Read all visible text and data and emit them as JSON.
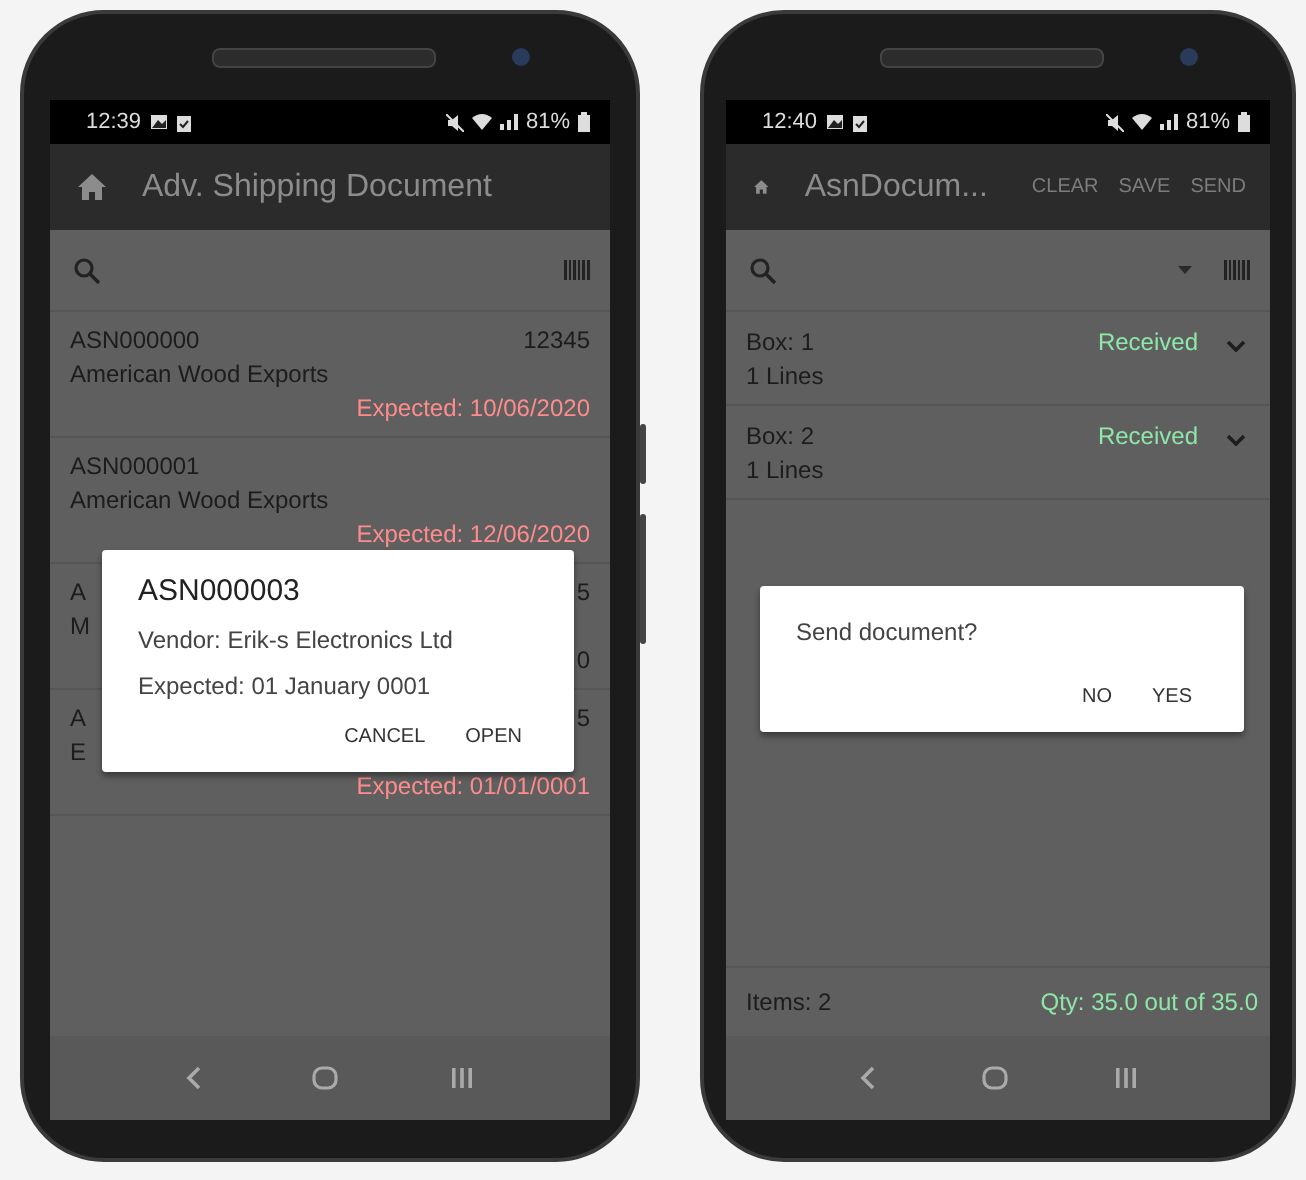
{
  "phones": [
    {
      "status_bar": {
        "time": "12:39",
        "battery": "81%"
      },
      "app_bar": {
        "title": "Adv. Shipping Document"
      },
      "search_bar": {
        "dropdown": false
      },
      "list": [
        {
          "kind": "document",
          "id": "ASN000000",
          "number": "12345",
          "vendor": "American Wood Exports",
          "expected": "Expected: 10/06/2020",
          "late": true
        },
        {
          "kind": "document",
          "id": "ASN000001",
          "vendor": "American Wood Exports",
          "expected": "Expected: 12/06/2020",
          "late": true
        },
        {
          "kind": "document",
          "id": "A",
          "number": "5",
          "vendor": "M",
          "expected": "0",
          "late": false
        },
        {
          "kind": "document",
          "id": "A",
          "number": "5",
          "vendor": "E",
          "expected": "Expected: 01/01/0001",
          "late": true
        }
      ],
      "dialog": {
        "title": "ASN000003",
        "lines": [
          "Vendor: Erik-s Electronics Ltd",
          "Expected: 01 January 0001"
        ],
        "buttons": [
          "CANCEL",
          "OPEN"
        ]
      }
    },
    {
      "status_bar": {
        "time": "12:40",
        "battery": "81%"
      },
      "app_bar": {
        "title": "AsnDocum...",
        "actions": [
          "CLEAR",
          "SAVE",
          "SEND"
        ]
      },
      "search_bar": {
        "dropdown": true
      },
      "list": [
        {
          "kind": "box",
          "title": "Box: 1",
          "lines": "1 Lines",
          "status": "Received"
        },
        {
          "kind": "box",
          "title": "Box: 2",
          "lines": "1 Lines",
          "status": "Received"
        }
      ],
      "dialog": {
        "lines": [
          "Send document?"
        ],
        "buttons": [
          "NO",
          "YES"
        ]
      },
      "footer": {
        "items": "Items: 2",
        "qty": "Qty: 35.0 out of 35.0"
      }
    }
  ]
}
